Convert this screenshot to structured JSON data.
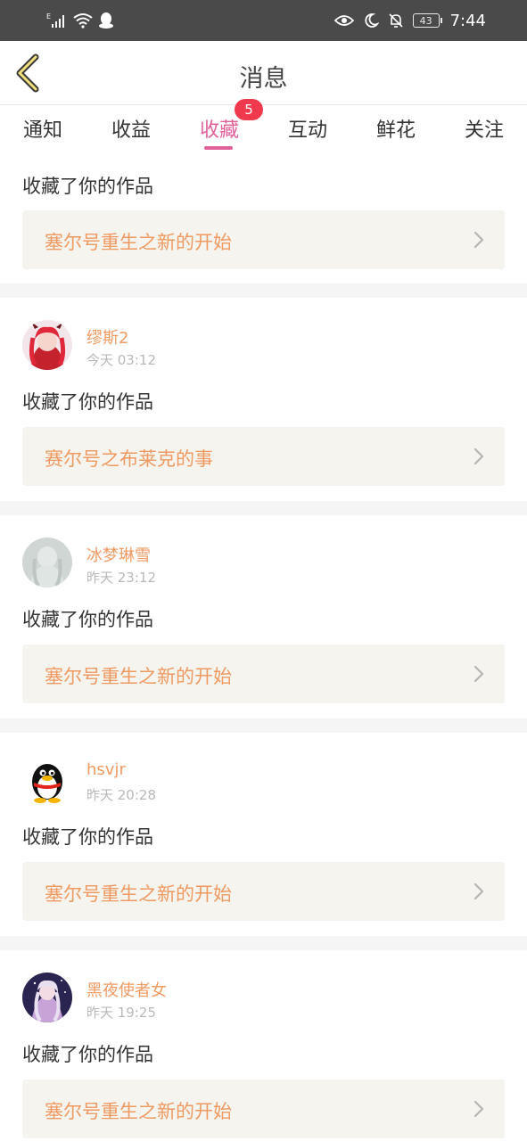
{
  "statusbar": {
    "signal_label": "E",
    "battery": "43",
    "time": "7:44"
  },
  "header": {
    "title": "消息"
  },
  "tabs": [
    {
      "label": "通知"
    },
    {
      "label": "收益"
    },
    {
      "label": "收藏",
      "active": true,
      "badge": "5"
    },
    {
      "label": "互动"
    },
    {
      "label": "鲜花"
    },
    {
      "label": "关注"
    }
  ],
  "colors": {
    "accent": "#e0609a",
    "badge": "#f0394d",
    "username": "#ef9a62",
    "work_box_bg": "#f5f4ee"
  },
  "feed": {
    "partial": {
      "action": "收藏了你的作品",
      "work": "塞尔号重生之新的开始"
    },
    "items": [
      {
        "username": "缪斯2",
        "time": "今天 03:12",
        "action": "收藏了你的作品",
        "work": "赛尔号之布莱克的事"
      },
      {
        "username": "冰梦琳雪",
        "time": "昨天 23:12",
        "action": "收藏了你的作品",
        "work": "塞尔号重生之新的开始"
      },
      {
        "username": "hsvjr",
        "time": "昨天 20:28",
        "action": "收藏了你的作品",
        "work": "塞尔号重生之新的开始"
      },
      {
        "username": "黑夜使者女",
        "time": "昨天 19:25",
        "action": "收藏了你的作品",
        "work": "塞尔号重生之新的开始"
      }
    ]
  }
}
